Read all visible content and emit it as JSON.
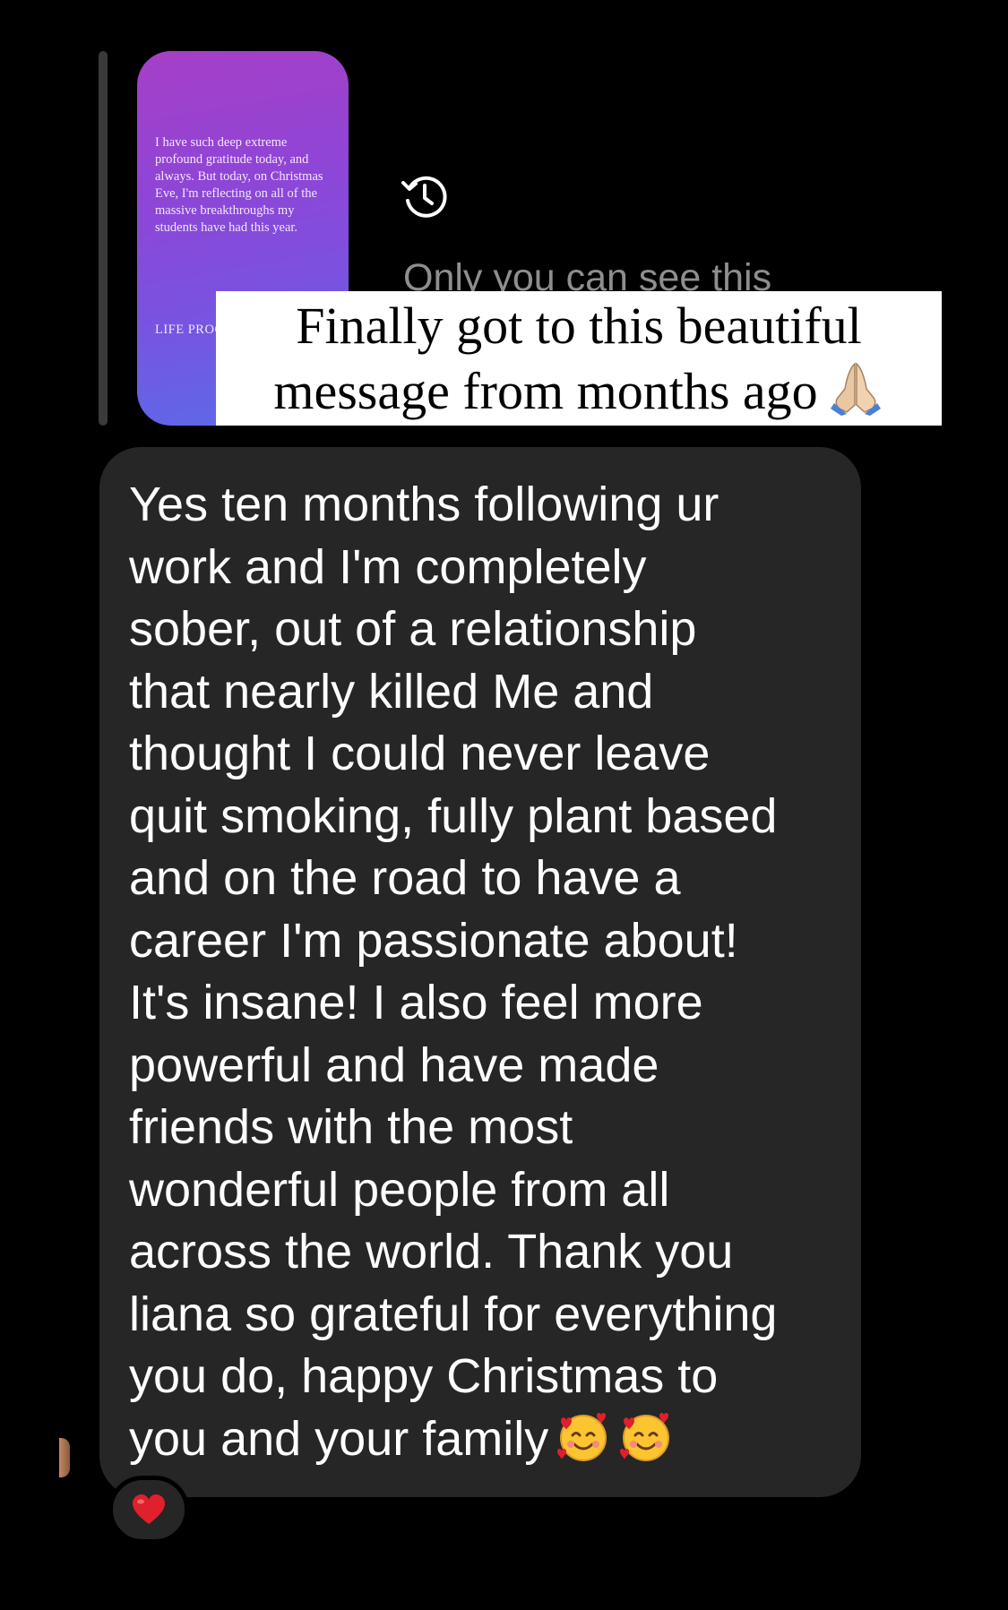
{
  "story": {
    "text": "I have such deep extreme profound gratitude today, and always. But today, on Christmas Eve, I'm reflecting on all of the massive breakthroughs my students have had this year.",
    "tag": "LIFE PROOF!!"
  },
  "story_status": "Only you can see this",
  "caption": {
    "line1": "Finally got to this beautiful",
    "line2": "message from months ago"
  },
  "message": {
    "lines": [
      "Yes ten months following ur",
      "work  and I'm completely",
      "sober, out of a relationship",
      "that nearly killed Me and",
      "thought I could never leave",
      "quit smoking, fully plant based",
      "and on the road to have a",
      "career I'm passionate about!",
      "It's insane! I also feel more",
      "powerful and have made",
      "friends with the most",
      "wonderful people from all",
      "across the world. Thank you",
      "liana so grateful for everything",
      "you do, happy Christmas to",
      "you and your family"
    ]
  },
  "icons": {
    "history": "history-icon",
    "pray": "folded-hands-icon",
    "smile_hearts": "smiling-face-with-hearts-icon",
    "reaction": "red-heart-icon"
  },
  "colors": {
    "background": "#000000",
    "bubble": "#262626",
    "story_gradient_start": "#a63fc7",
    "story_gradient_end": "#5a6bea",
    "heart": "#e0202c"
  }
}
